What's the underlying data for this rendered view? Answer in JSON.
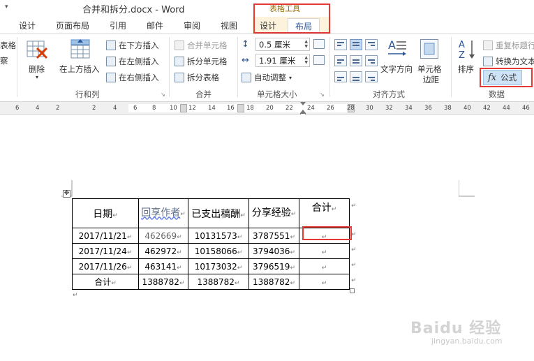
{
  "window": {
    "title": "合并和拆分.docx - Word",
    "contextual_group": "表格工具"
  },
  "tabs": [
    "设计",
    "页面布局",
    "引用",
    "邮件",
    "审阅",
    "视图",
    "设计",
    "布局"
  ],
  "ribbon": {
    "left_partial": [
      "表格",
      "察"
    ],
    "delete_label": "删除",
    "insert_above_label": "在上方插入",
    "insert_below_label": "在下方插入",
    "insert_left_label": "在左侧插入",
    "insert_right_label": "在右侧插入",
    "group_rows_cols": "行和列",
    "merge_cells_label": "合并单元格",
    "split_cells_label": "拆分单元格",
    "split_table_label": "拆分表格",
    "group_merge": "合并",
    "height_value": "0.5 厘米",
    "width_value": "1.91 厘米",
    "autofit_label": "自动调整",
    "group_cell_size": "单元格大小",
    "text_direction_label": "文字方向",
    "cell_margins_label_1": "单元格",
    "cell_margins_label_2": "边距",
    "group_alignment": "对齐方式",
    "sort_label": "排序",
    "repeat_header_label": "重复标题行",
    "convert_to_text_label": "转换为文本",
    "formula_label": "公式",
    "group_data": "数据"
  },
  "ruler": {
    "ticks": [
      "6",
      "4",
      "2",
      "2",
      "4",
      "6",
      "8",
      "10",
      "12",
      "14",
      "16",
      "18",
      "20",
      "22",
      "24",
      "26",
      "28",
      "30",
      "32",
      "34",
      "36",
      "38",
      "40",
      "42",
      "44",
      "46"
    ]
  },
  "document": {
    "table": {
      "headers": [
        "日期",
        "回享作者",
        "已支出稿酬",
        "分享经验",
        "合计"
      ],
      "rows": [
        [
          "2017/11/21",
          "462669",
          "10131573",
          "3787551",
          ""
        ],
        [
          "2017/11/24",
          "462972",
          "10158066",
          "3794036",
          ""
        ],
        [
          "2017/11/26",
          "463141",
          "10173032",
          "3796519",
          ""
        ],
        [
          "合计",
          "1388782",
          "1388782",
          "1388782",
          ""
        ]
      ]
    }
  },
  "watermark": {
    "brand": "Baidu 经验",
    "url": "jingyan.baidu.com"
  }
}
